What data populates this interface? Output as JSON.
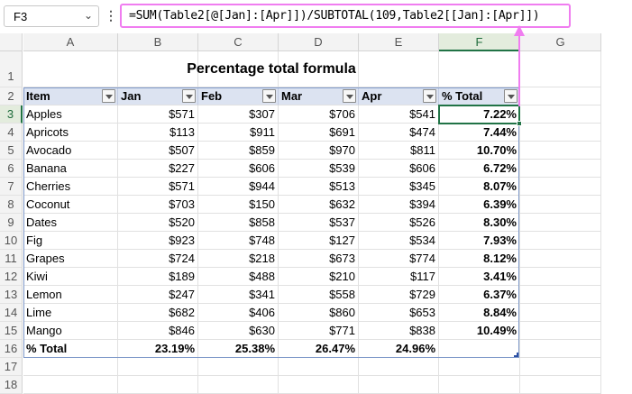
{
  "formula_bar": {
    "name_box": "F3",
    "formula": "=SUM(Table2[@[Jan]:[Apr]])/SUBTOTAL(109,Table2[[Jan]:[Apr]])"
  },
  "columns": [
    "A",
    "B",
    "C",
    "D",
    "E",
    "F",
    "G"
  ],
  "rows": [
    "1",
    "2",
    "3",
    "4",
    "5",
    "6",
    "7",
    "8",
    "9",
    "10",
    "11",
    "12",
    "13",
    "14",
    "15",
    "16",
    "17",
    "18"
  ],
  "title": "Percentage total formula",
  "table": {
    "headers": [
      "Item",
      "Jan",
      "Feb",
      "Mar",
      "Apr",
      "% Total"
    ],
    "rows": [
      [
        "Apples",
        "$571",
        "$307",
        "$706",
        "$541",
        "7.22%"
      ],
      [
        "Apricots",
        "$113",
        "$911",
        "$691",
        "$474",
        "7.44%"
      ],
      [
        "Avocado",
        "$507",
        "$859",
        "$970",
        "$811",
        "10.70%"
      ],
      [
        "Banana",
        "$227",
        "$606",
        "$539",
        "$606",
        "6.72%"
      ],
      [
        "Cherries",
        "$571",
        "$944",
        "$513",
        "$345",
        "8.07%"
      ],
      [
        "Coconut",
        "$703",
        "$150",
        "$632",
        "$394",
        "6.39%"
      ],
      [
        "Dates",
        "$520",
        "$858",
        "$537",
        "$526",
        "8.30%"
      ],
      [
        "Fig",
        "$923",
        "$748",
        "$127",
        "$534",
        "7.93%"
      ],
      [
        "Grapes",
        "$724",
        "$218",
        "$673",
        "$774",
        "8.12%"
      ],
      [
        "Kiwi",
        "$189",
        "$488",
        "$210",
        "$117",
        "3.41%"
      ],
      [
        "Lemon",
        "$247",
        "$341",
        "$558",
        "$729",
        "6.37%"
      ],
      [
        "Lime",
        "$682",
        "$406",
        "$860",
        "$653",
        "8.84%"
      ],
      [
        "Mango",
        "$846",
        "$630",
        "$771",
        "$838",
        "10.49%"
      ]
    ],
    "total_row": [
      "% Total",
      "23.19%",
      "25.38%",
      "26.47%",
      "24.96%",
      ""
    ]
  },
  "selected_cell": "F3",
  "colors": {
    "annotation": "#f07df0",
    "selection": "#217346",
    "table_header": "#dce3f1"
  }
}
